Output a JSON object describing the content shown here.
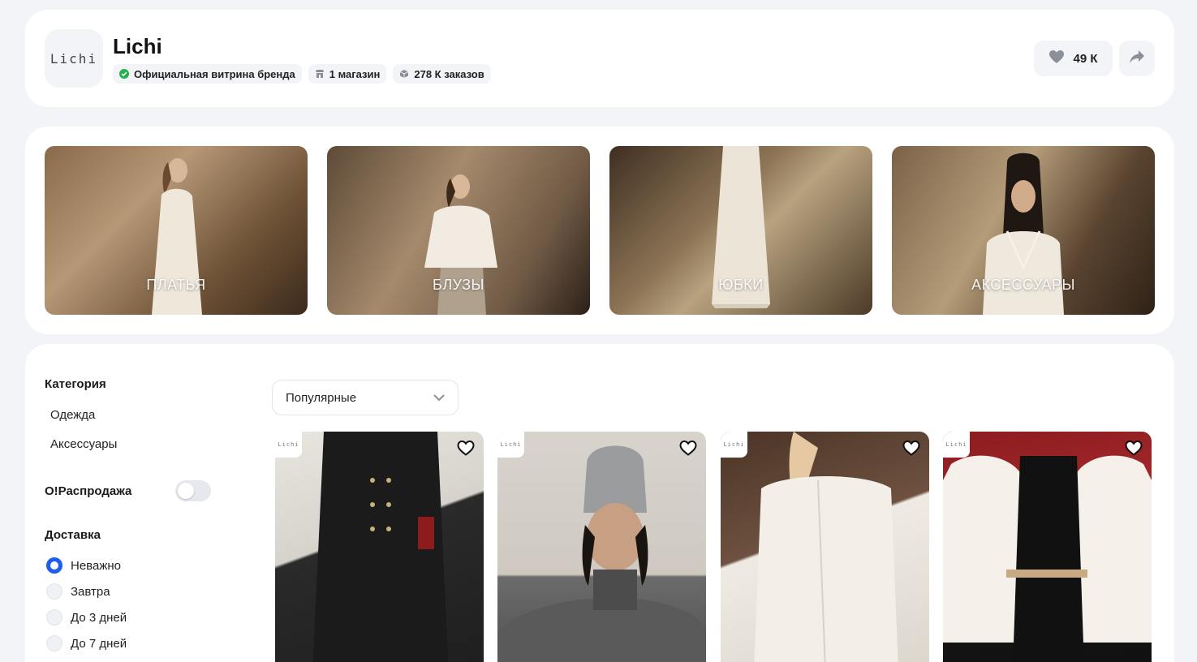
{
  "brand": {
    "logo_text": "Lichi",
    "name": "Lichi",
    "badges": [
      {
        "icon": "verified-check-icon",
        "label": "Официальная витрина бренда",
        "color": "#22b14c"
      },
      {
        "icon": "store-icon",
        "label": "1 магазин"
      },
      {
        "icon": "box-icon",
        "label": "278 К заказов"
      }
    ],
    "favorites_count": "49 К"
  },
  "banners": [
    {
      "label": "ПЛАТЬЯ"
    },
    {
      "label": "БЛУЗЫ"
    },
    {
      "label": "ЮБКИ"
    },
    {
      "label": "АКСЕССУАРЫ"
    }
  ],
  "filters": {
    "category_title": "Категория",
    "categories": [
      "Одежда",
      "Аксессуары"
    ],
    "sale_label": "О!Распродажа",
    "sale_enabled": false,
    "delivery_title": "Доставка",
    "delivery_options": [
      "Неважно",
      "Завтра",
      "До 3 дней",
      "До 7 дней"
    ],
    "delivery_selected": "Неважно"
  },
  "sort": {
    "selected": "Популярные"
  },
  "products": [
    {
      "logo_text": "Lichi"
    },
    {
      "logo_text": "Lichi"
    },
    {
      "logo_text": "Lichi"
    },
    {
      "logo_text": "Lichi"
    }
  ],
  "colors": {
    "accent": "#1f5cf0",
    "verified": "#22b14c"
  }
}
